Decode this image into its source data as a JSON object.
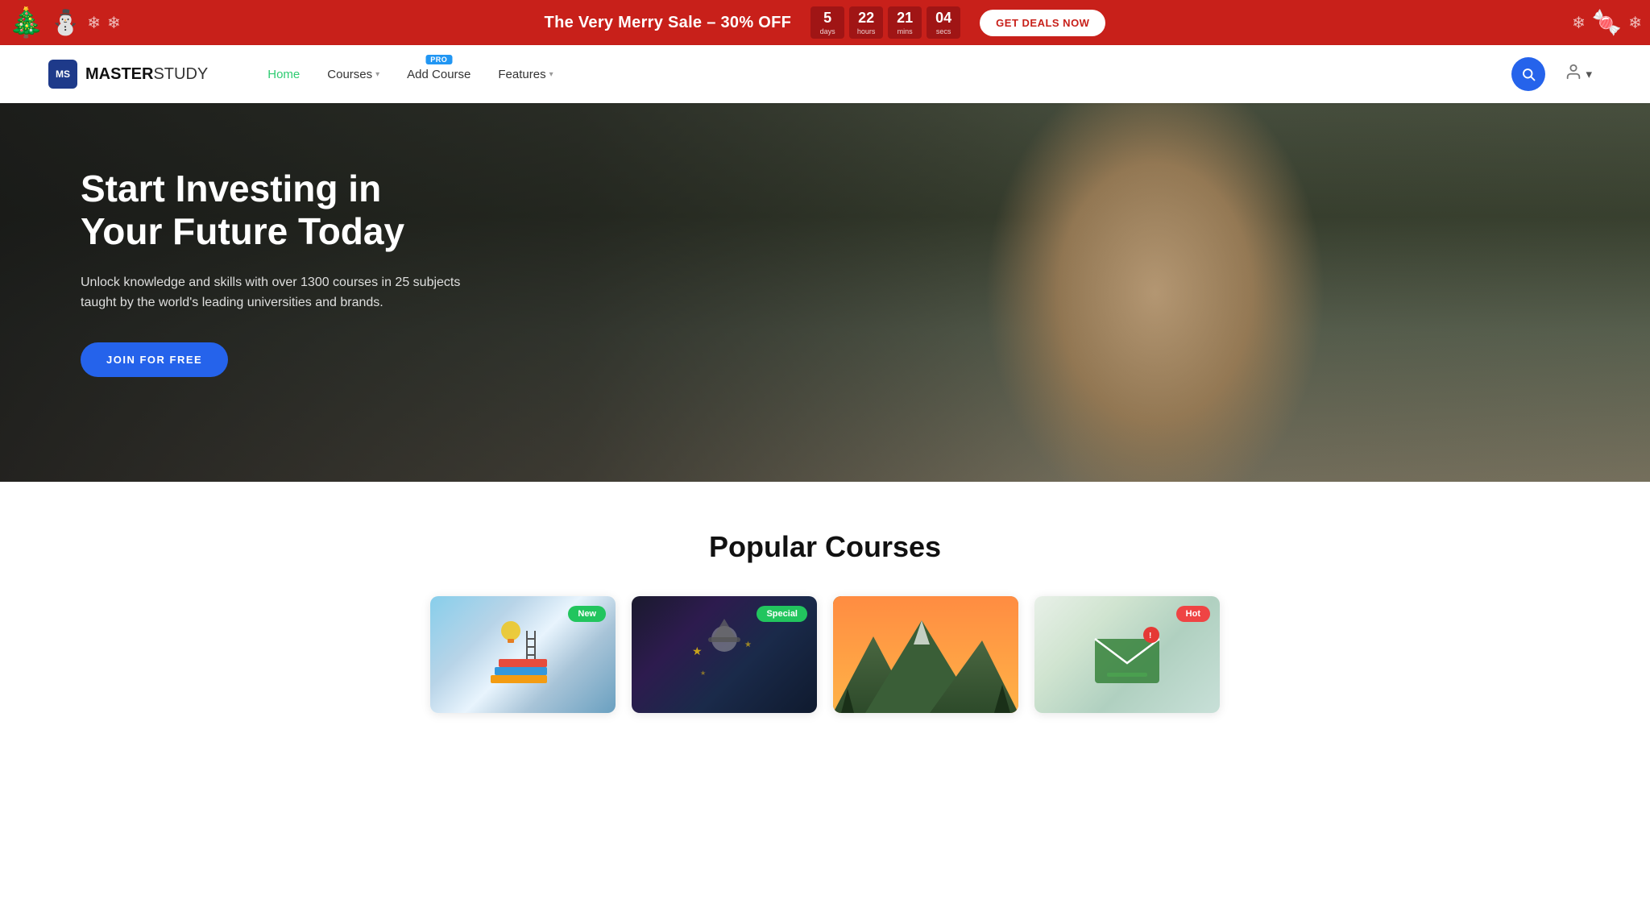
{
  "banner": {
    "sale_text": "The Very Merry Sale – 30% OFF",
    "cta_label": "GET DEALS NOW",
    "countdown": [
      {
        "number": "5",
        "label": "days"
      },
      {
        "number": "22",
        "label": "hours"
      },
      {
        "number": "21",
        "label": "mins"
      },
      {
        "number": "04",
        "label": "secs"
      }
    ]
  },
  "navbar": {
    "logo_initials": "MS",
    "logo_brand_bold": "MASTER",
    "logo_brand_light": "STUDY",
    "nav_items": [
      {
        "label": "Home",
        "active": true,
        "has_dropdown": false
      },
      {
        "label": "Courses",
        "active": false,
        "has_dropdown": true
      },
      {
        "label": "Add Course",
        "active": false,
        "has_dropdown": false,
        "pro": true
      },
      {
        "label": "Features",
        "active": false,
        "has_dropdown": true
      }
    ]
  },
  "hero": {
    "title": "Start Investing in Your Future Today",
    "subtitle": "Unlock knowledge and skills with over 1300 courses in 25 subjects taught by the world's leading universities and brands.",
    "cta_label": "JOIN FOR FREE"
  },
  "popular_courses": {
    "section_title": "Popular Courses",
    "cards": [
      {
        "badge": "New",
        "badge_type": "new"
      },
      {
        "badge": "Special",
        "badge_type": "special"
      },
      {
        "badge": "",
        "badge_type": "none"
      },
      {
        "badge": "Hot",
        "badge_type": "hot"
      }
    ]
  }
}
